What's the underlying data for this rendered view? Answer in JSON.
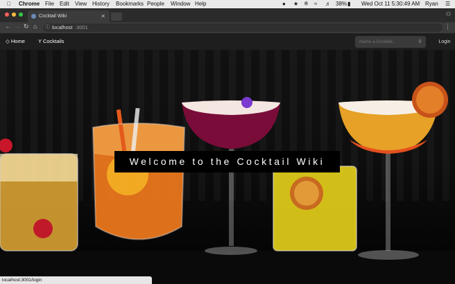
{
  "macos_menubar": {
    "apple_icon": "apple-icon",
    "app": "Chrome",
    "menus": [
      "File",
      "Edit",
      "View",
      "History",
      "Bookmarks",
      "People",
      "Window",
      "Help"
    ],
    "battery": "38%",
    "datetime": "Wed Oct 11  5:30:49 AM",
    "user": "Ryan"
  },
  "browser": {
    "tab_title": "Cocktail Wiki",
    "url_host": "localhost",
    "url_port": ":3001",
    "status_url": "localhost:3001/login"
  },
  "navbar": {
    "home": "Home",
    "cocktails": "Cocktails",
    "search_placeholder": "Name a Cocktail...",
    "login": "Login"
  },
  "hero": {
    "title": "Welcome to the Cocktail Wiki"
  },
  "colors": {
    "navbar_bg": "#1e1e1e",
    "banner_bg": "#000000",
    "tab_bg": "#3b3b3b"
  }
}
